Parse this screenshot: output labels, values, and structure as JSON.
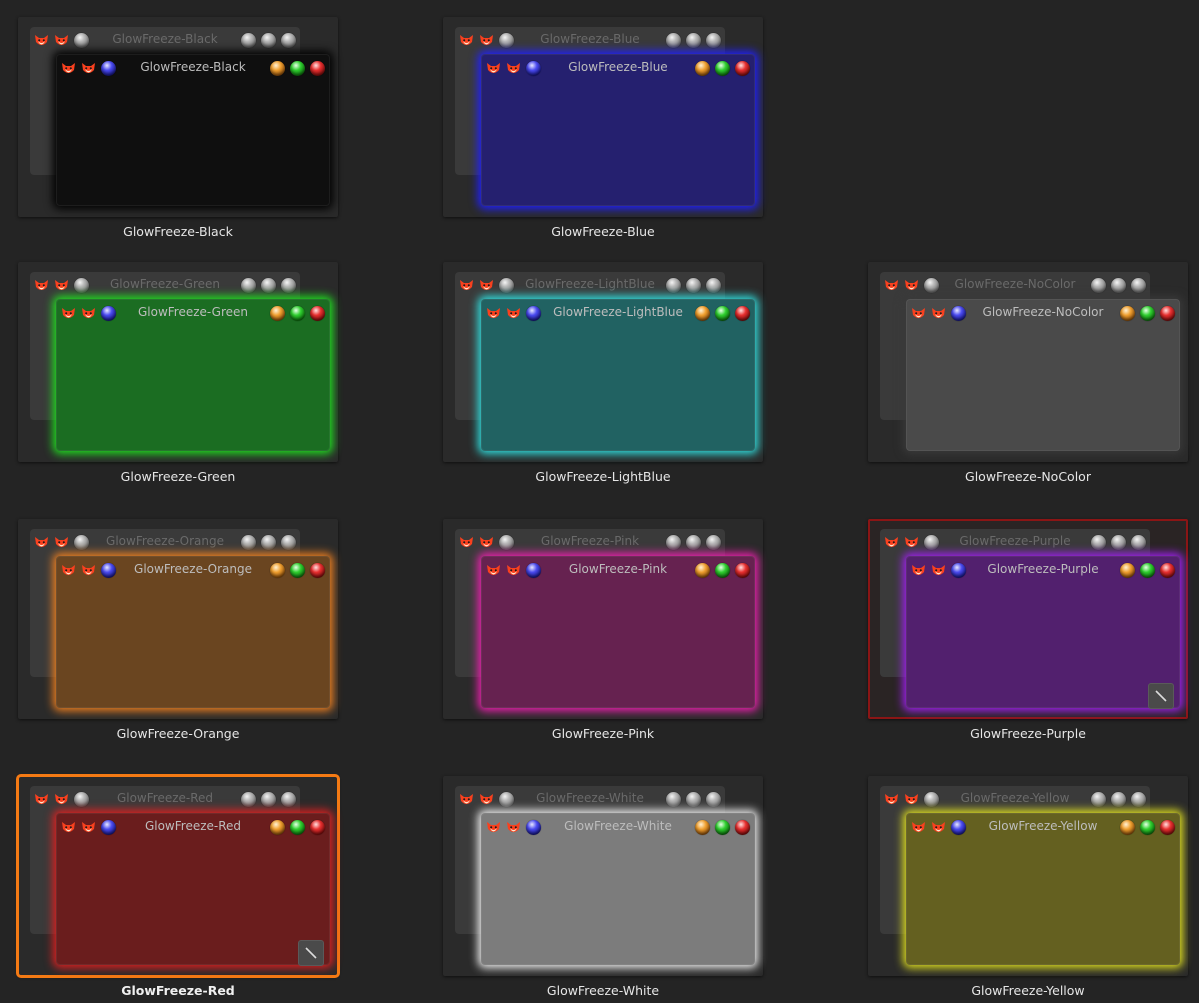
{
  "themes": [
    {
      "name": "GlowFreeze-Black",
      "fill": "#0f0f0f",
      "glow": "#000000",
      "col": 0,
      "row": 0
    },
    {
      "name": "GlowFreeze-Blue",
      "fill": "#25206f",
      "glow": "#2020ff",
      "col": 1,
      "row": 0
    },
    {
      "name": "GlowFreeze-Green",
      "fill": "#1b6d22",
      "glow": "#20e020",
      "col": 0,
      "row": 1
    },
    {
      "name": "GlowFreeze-LightBlue",
      "fill": "#216262",
      "glow": "#30e0e0",
      "col": 1,
      "row": 1
    },
    {
      "name": "GlowFreeze-NoColor",
      "fill": "#4a4a4a",
      "glow": "#3a3a3a",
      "col": 2,
      "row": 1
    },
    {
      "name": "GlowFreeze-Orange",
      "fill": "#6a4520",
      "glow": "#f08020",
      "col": 0,
      "row": 2
    },
    {
      "name": "GlowFreeze-Pink",
      "fill": "#662250",
      "glow": "#f020b0",
      "col": 1,
      "row": 2
    },
    {
      "name": "GlowFreeze-Purple",
      "fill": "#52206e",
      "glow": "#a020f0",
      "col": 2,
      "row": 2
    },
    {
      "name": "GlowFreeze-Red",
      "fill": "#6a1d1d",
      "glow": "#e02020",
      "col": 0,
      "row": 3
    },
    {
      "name": "GlowFreeze-White",
      "fill": "#7c7c7c",
      "glow": "#f0f0f0",
      "col": 1,
      "row": 3
    },
    {
      "name": "GlowFreeze-Yellow",
      "fill": "#646020",
      "glow": "#e0e020",
      "col": 2,
      "row": 3
    }
  ],
  "active_theme": "GlowFreeze-Red",
  "hovered_theme": "GlowFreeze-Purple",
  "icons": {
    "left_buttons": [
      "fox-icon",
      "fox-icon",
      "menu-orb-icon"
    ],
    "right_buttons": [
      "minimize-orb-icon",
      "maximize-orb-icon",
      "close-orb-icon"
    ],
    "edit": "edit-pencil-icon"
  },
  "colors": {
    "active_border": "#f47a14",
    "hover_border": "#8b1515",
    "background": "#242424"
  }
}
